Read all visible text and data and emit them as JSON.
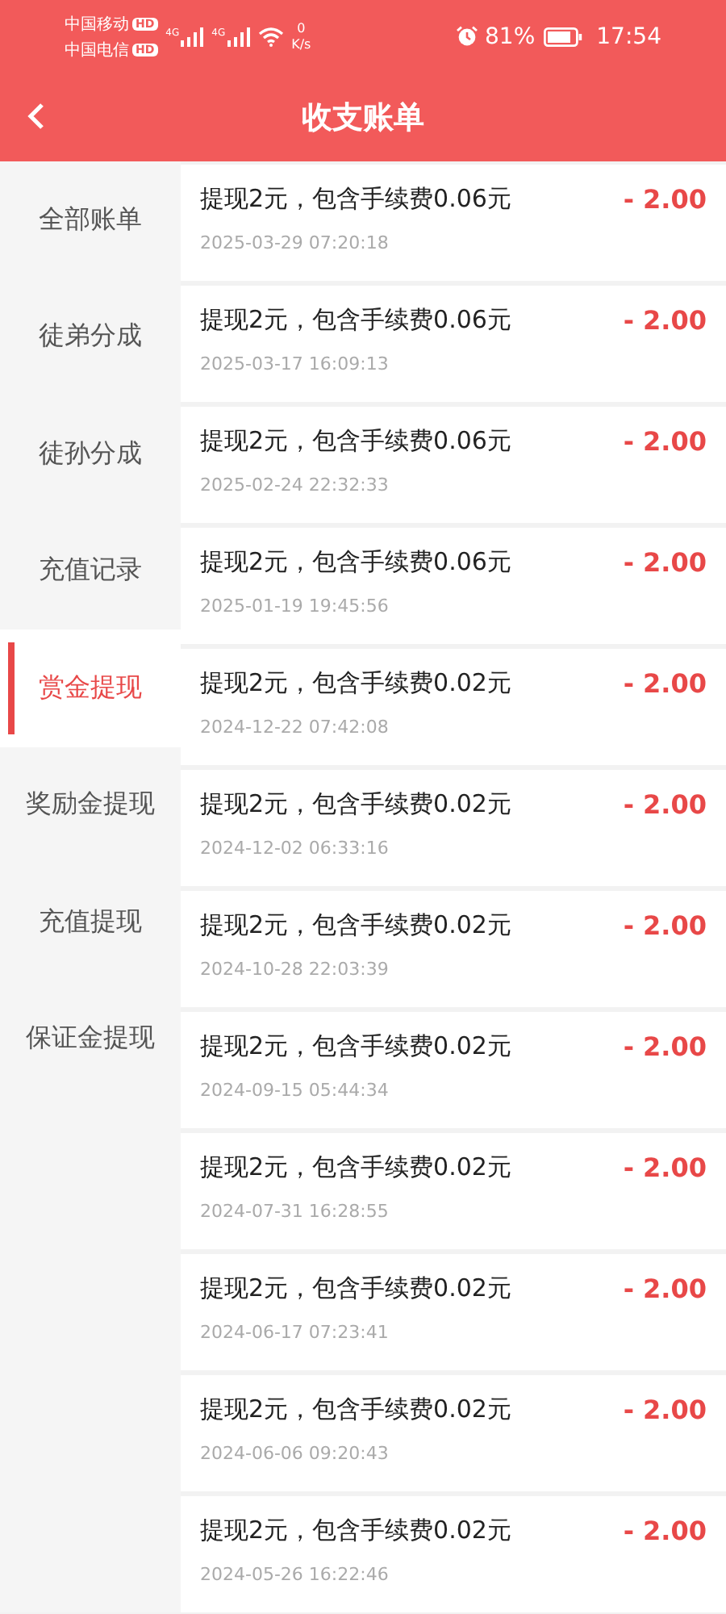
{
  "status_bar": {
    "carriers": [
      {
        "name": "中国移动",
        "badge": "HD"
      },
      {
        "name": "中国电信",
        "badge": "HD"
      }
    ],
    "networks": [
      "4G",
      "4G"
    ],
    "speed_value": "0",
    "speed_unit": "K/s",
    "battery": "81%",
    "time": "17:54"
  },
  "header": {
    "title": "收支账单"
  },
  "sidebar": {
    "items": [
      {
        "label": "全部账单",
        "selected": false
      },
      {
        "label": "徒弟分成",
        "selected": false
      },
      {
        "label": "徒孙分成",
        "selected": false
      },
      {
        "label": "充值记录",
        "selected": false
      },
      {
        "label": "赏金提现",
        "selected": true
      },
      {
        "label": "奖励金提现",
        "selected": false
      },
      {
        "label": "充值提现",
        "selected": false
      },
      {
        "label": "保证金提现",
        "selected": false
      }
    ]
  },
  "transactions": [
    {
      "description": "提现2元，包含手续费0.06元",
      "time": "2025-03-29 07:20:18",
      "amount": "- 2.00"
    },
    {
      "description": "提现2元，包含手续费0.06元",
      "time": "2025-03-17 16:09:13",
      "amount": "- 2.00"
    },
    {
      "description": "提现2元，包含手续费0.06元",
      "time": "2025-02-24 22:32:33",
      "amount": "- 2.00"
    },
    {
      "description": "提现2元，包含手续费0.06元",
      "time": "2025-01-19 19:45:56",
      "amount": "- 2.00"
    },
    {
      "description": "提现2元，包含手续费0.02元",
      "time": "2024-12-22 07:42:08",
      "amount": "- 2.00"
    },
    {
      "description": "提现2元，包含手续费0.02元",
      "time": "2024-12-02 06:33:16",
      "amount": "- 2.00"
    },
    {
      "description": "提现2元，包含手续费0.02元",
      "time": "2024-10-28 22:03:39",
      "amount": "- 2.00"
    },
    {
      "description": "提现2元，包含手续费0.02元",
      "time": "2024-09-15 05:44:34",
      "amount": "- 2.00"
    },
    {
      "description": "提现2元，包含手续费0.02元",
      "time": "2024-07-31 16:28:55",
      "amount": "- 2.00"
    },
    {
      "description": "提现2元，包含手续费0.02元",
      "time": "2024-06-17 07:23:41",
      "amount": "- 2.00"
    },
    {
      "description": "提现2元，包含手续费0.02元",
      "time": "2024-06-06 09:20:43",
      "amount": "- 2.00"
    },
    {
      "description": "提现2元，包含手续费0.02元",
      "time": "2024-05-26 16:22:46",
      "amount": "- 2.00"
    }
  ]
}
